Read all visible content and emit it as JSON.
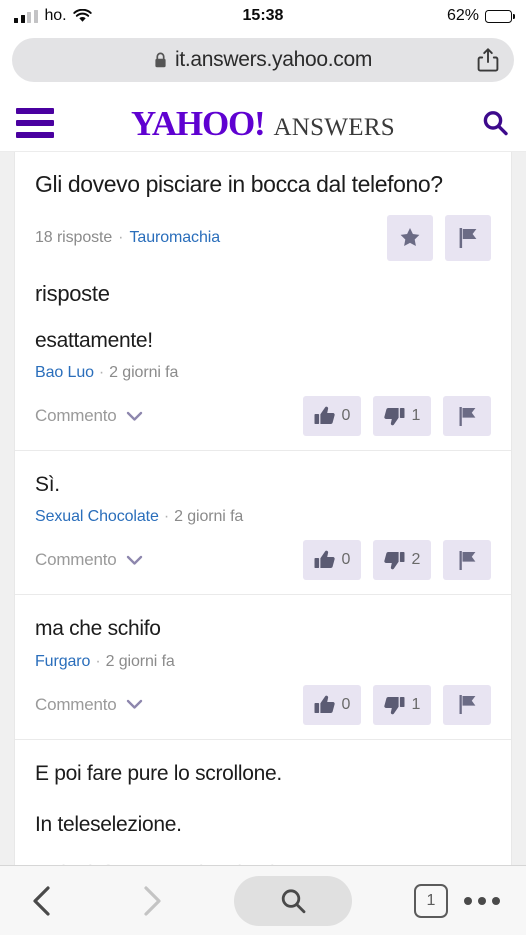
{
  "status_bar": {
    "carrier": "ho.",
    "time": "15:38",
    "battery_percent": "62%",
    "battery_level": 62,
    "signal_icon": "signal-bars-icon",
    "wifi_icon": "wifi-icon"
  },
  "browser": {
    "url": "it.answers.yahoo.com",
    "lock_icon": "lock-icon",
    "share_icon": "share-icon",
    "toolbar": {
      "back_icon": "chevron-left-icon",
      "forward_icon": "chevron-right-icon",
      "search_icon": "search-icon",
      "tab_count": "1",
      "more_icon": "ellipsis-icon"
    }
  },
  "site_header": {
    "menu_icon": "hamburger-menu-icon",
    "brand_primary": "YAHOO!",
    "brand_secondary": "ANSWERS",
    "search_icon": "search-icon",
    "brand_color": "#5f01d1"
  },
  "question": {
    "title": "Gli dovevo pisciare in bocca dal telefono?",
    "answer_count": "18 risposte",
    "separator": "·",
    "category": "Tauromachia",
    "star_icon": "star-icon",
    "flag_icon": "flag-icon"
  },
  "answers_section": {
    "heading": "risposte",
    "comment_label": "Commento",
    "chevron_icon": "chevron-down-icon",
    "thumbs_up_icon": "thumbs-up-icon",
    "thumbs_down_icon": "thumbs-down-icon",
    "flag_icon": "flag-icon",
    "items": [
      {
        "text": "esattamente!",
        "author": "Bao Luo",
        "time_ago": "2 giorni fa",
        "upvotes": "0",
        "downvotes": "1"
      },
      {
        "text": "Sì.",
        "author": "Sexual Chocolate",
        "time_ago": "2 giorni fa",
        "upvotes": "0",
        "downvotes": "2"
      },
      {
        "text": "ma che schifo",
        "author": "Furgaro",
        "time_ago": "2 giorni fa",
        "upvotes": "0",
        "downvotes": "1"
      }
    ],
    "partial_answer": {
      "line1": "E poi fare pure lo scrollone.",
      "line2": "In teleselezione."
    }
  },
  "colors": {
    "brand_purple": "#5f01d1",
    "link_blue": "#2a6ebb",
    "button_lavender": "#e8e4f2",
    "muted_text": "#8b8b8b"
  }
}
